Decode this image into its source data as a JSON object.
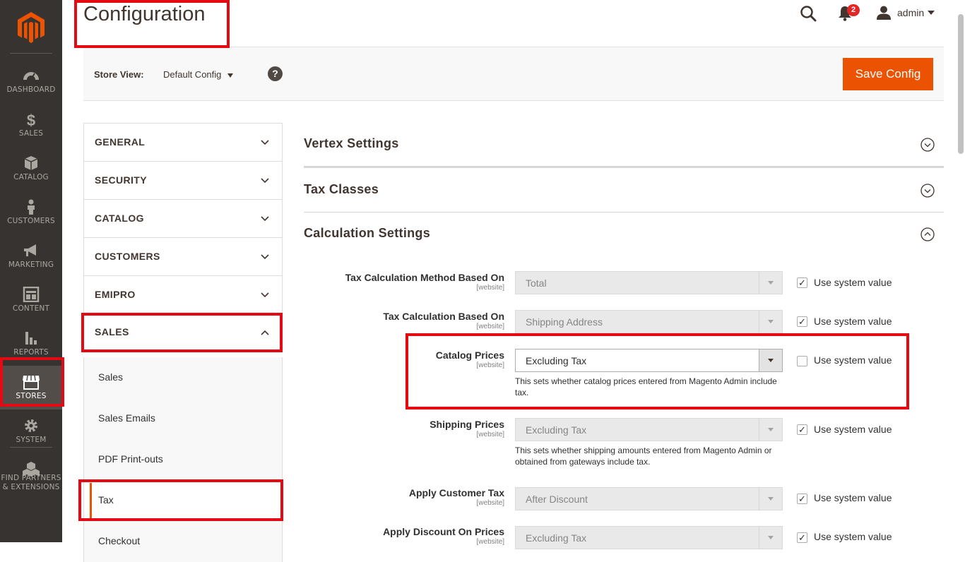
{
  "menu": {
    "items": [
      {
        "label": "DASHBOARD",
        "icon": "dashboard-icon"
      },
      {
        "label": "SALES",
        "icon": "dollar-icon"
      },
      {
        "label": "CATALOG",
        "icon": "box-icon"
      },
      {
        "label": "CUSTOMERS",
        "icon": "person-icon"
      },
      {
        "label": "MARKETING",
        "icon": "megaphone-icon"
      },
      {
        "label": "CONTENT",
        "icon": "layout-icon"
      },
      {
        "label": "REPORTS",
        "icon": "bar-chart-icon"
      },
      {
        "label": "STORES",
        "icon": "store-icon"
      },
      {
        "label": "SYSTEM",
        "icon": "gear-icon"
      },
      {
        "label": "FIND PARTNERS",
        "label2": "& EXTENSIONS",
        "icon": "cubes-icon"
      }
    ]
  },
  "header": {
    "title": "Configuration",
    "notifications_count": "2",
    "user_name": "admin"
  },
  "scope": {
    "store_view_label": "Store View:",
    "store_view_value": "Default Config",
    "help": "?",
    "save_label": "Save Config"
  },
  "tabs": {
    "groups": [
      {
        "label": "GENERAL"
      },
      {
        "label": "SECURITY"
      },
      {
        "label": "CATALOG"
      },
      {
        "label": "CUSTOMERS"
      },
      {
        "label": "EMIPRO"
      },
      {
        "label": "SALES"
      }
    ],
    "sales_items": [
      {
        "label": "Sales"
      },
      {
        "label": "Sales Emails"
      },
      {
        "label": "PDF Print-outs"
      },
      {
        "label": "Tax"
      },
      {
        "label": "Checkout"
      }
    ]
  },
  "sections": [
    {
      "title": "Vertex Settings"
    },
    {
      "title": "Tax Classes"
    },
    {
      "title": "Calculation Settings"
    }
  ],
  "fields": [
    {
      "label": "Tax Calculation Method Based On",
      "scope": "[website]",
      "value": "Total",
      "use_system": true
    },
    {
      "label": "Tax Calculation Based On",
      "scope": "[website]",
      "value": "Shipping Address",
      "use_system": true
    },
    {
      "label": "Catalog Prices",
      "scope": "[website]",
      "value": "Excluding Tax",
      "use_system": false,
      "note": "This sets whether catalog prices entered from Magento Admin include tax."
    },
    {
      "label": "Shipping Prices",
      "scope": "[website]",
      "value": "Excluding Tax",
      "use_system": true,
      "note": "This sets whether shipping amounts entered from Magento Admin or obtained from gateways include tax."
    },
    {
      "label": "Apply Customer Tax",
      "scope": "[website]",
      "value": "After Discount",
      "use_system": true
    },
    {
      "label": "Apply Discount On Prices",
      "scope": "[website]",
      "value": "Excluding Tax",
      "use_system": true
    }
  ],
  "use_system_label": "Use system value",
  "check_mark": "✓",
  "colors": {
    "accent": "#eb5202",
    "menu_bg": "#373330",
    "highlight": "#e50914",
    "badge": "#e22626"
  }
}
